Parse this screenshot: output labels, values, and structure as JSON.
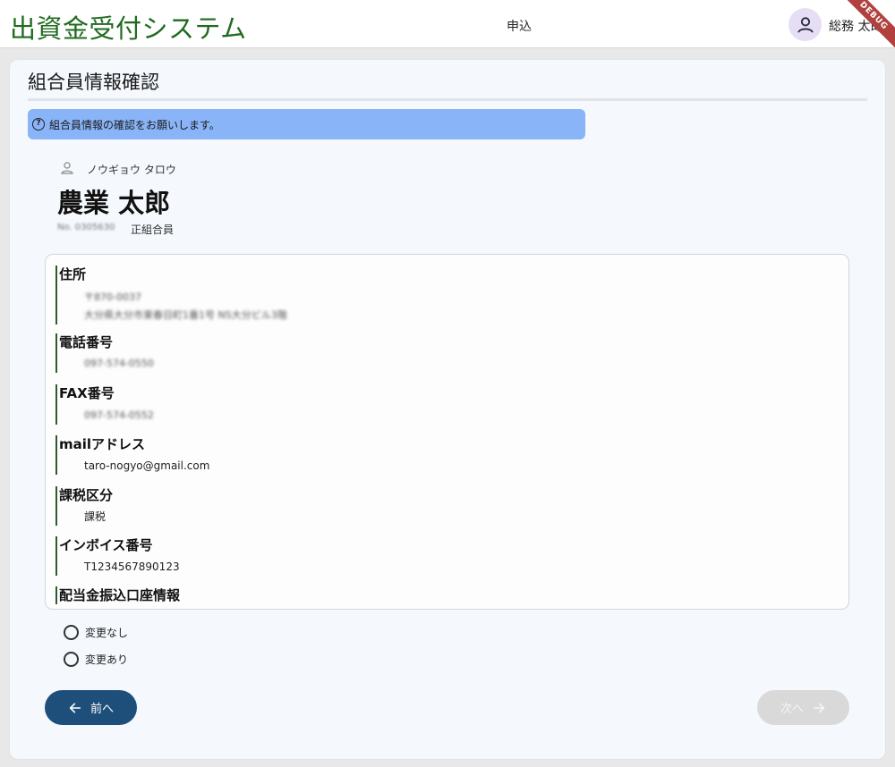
{
  "app": {
    "title": "出資金受付システム",
    "nav_label": "申込",
    "user_name": "総務 太郎",
    "debug_label": "DEBUG"
  },
  "page": {
    "title": "組合員情報確認",
    "info_message": "組合員情報の確認をお願いします。"
  },
  "member": {
    "kana": "ノウギョウ タロウ",
    "name": "農業 太郎",
    "number": "No. 0305630",
    "type": "正組合員"
  },
  "details": {
    "address_label": "住所",
    "address_postal": "〒870-0037",
    "address_line": "大分県大分市東春日町1番1号 NS大分ビル3階",
    "phone_label": "電話番号",
    "phone_value": "097-574-0550",
    "fax_label": "FAX番号",
    "fax_value": "097-574-0552",
    "mail_label": "mailアドレス",
    "mail_value": "taro-nogyo@gmail.com",
    "tax_label": "課税区分",
    "tax_value": "課税",
    "invoice_label": "インボイス番号",
    "invoice_value": "T1234567890123",
    "bank_label": "配当金振込口座情報"
  },
  "options": {
    "no_change": "変更なし",
    "change": "変更あり"
  },
  "buttons": {
    "prev": "前へ",
    "next": "次へ"
  },
  "colors": {
    "brand_green": "#1f6b1f",
    "primary_button": "#1e4f7b",
    "info_banner": "#8ab4f8",
    "disabled_button": "#d9d9d9"
  }
}
